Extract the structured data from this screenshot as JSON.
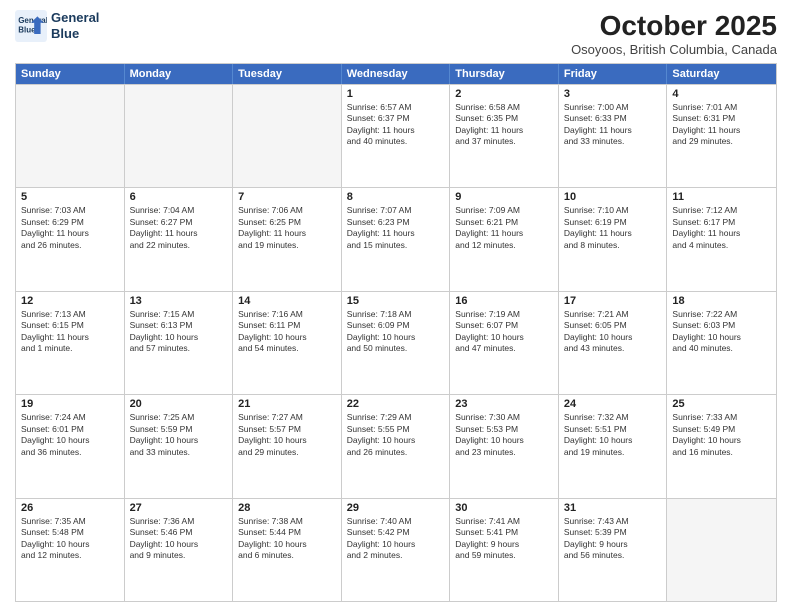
{
  "header": {
    "logo_line1": "General",
    "logo_line2": "Blue",
    "month_title": "October 2025",
    "subtitle": "Osoyoos, British Columbia, Canada"
  },
  "day_headers": [
    "Sunday",
    "Monday",
    "Tuesday",
    "Wednesday",
    "Thursday",
    "Friday",
    "Saturday"
  ],
  "weeks": [
    [
      {
        "day": "",
        "info": "",
        "empty": true
      },
      {
        "day": "",
        "info": "",
        "empty": true
      },
      {
        "day": "",
        "info": "",
        "empty": true
      },
      {
        "day": "1",
        "info": "Sunrise: 6:57 AM\nSunset: 6:37 PM\nDaylight: 11 hours\nand 40 minutes."
      },
      {
        "day": "2",
        "info": "Sunrise: 6:58 AM\nSunset: 6:35 PM\nDaylight: 11 hours\nand 37 minutes."
      },
      {
        "day": "3",
        "info": "Sunrise: 7:00 AM\nSunset: 6:33 PM\nDaylight: 11 hours\nand 33 minutes."
      },
      {
        "day": "4",
        "info": "Sunrise: 7:01 AM\nSunset: 6:31 PM\nDaylight: 11 hours\nand 29 minutes."
      }
    ],
    [
      {
        "day": "5",
        "info": "Sunrise: 7:03 AM\nSunset: 6:29 PM\nDaylight: 11 hours\nand 26 minutes."
      },
      {
        "day": "6",
        "info": "Sunrise: 7:04 AM\nSunset: 6:27 PM\nDaylight: 11 hours\nand 22 minutes."
      },
      {
        "day": "7",
        "info": "Sunrise: 7:06 AM\nSunset: 6:25 PM\nDaylight: 11 hours\nand 19 minutes."
      },
      {
        "day": "8",
        "info": "Sunrise: 7:07 AM\nSunset: 6:23 PM\nDaylight: 11 hours\nand 15 minutes."
      },
      {
        "day": "9",
        "info": "Sunrise: 7:09 AM\nSunset: 6:21 PM\nDaylight: 11 hours\nand 12 minutes."
      },
      {
        "day": "10",
        "info": "Sunrise: 7:10 AM\nSunset: 6:19 PM\nDaylight: 11 hours\nand 8 minutes."
      },
      {
        "day": "11",
        "info": "Sunrise: 7:12 AM\nSunset: 6:17 PM\nDaylight: 11 hours\nand 4 minutes."
      }
    ],
    [
      {
        "day": "12",
        "info": "Sunrise: 7:13 AM\nSunset: 6:15 PM\nDaylight: 11 hours\nand 1 minute."
      },
      {
        "day": "13",
        "info": "Sunrise: 7:15 AM\nSunset: 6:13 PM\nDaylight: 10 hours\nand 57 minutes."
      },
      {
        "day": "14",
        "info": "Sunrise: 7:16 AM\nSunset: 6:11 PM\nDaylight: 10 hours\nand 54 minutes."
      },
      {
        "day": "15",
        "info": "Sunrise: 7:18 AM\nSunset: 6:09 PM\nDaylight: 10 hours\nand 50 minutes."
      },
      {
        "day": "16",
        "info": "Sunrise: 7:19 AM\nSunset: 6:07 PM\nDaylight: 10 hours\nand 47 minutes."
      },
      {
        "day": "17",
        "info": "Sunrise: 7:21 AM\nSunset: 6:05 PM\nDaylight: 10 hours\nand 43 minutes."
      },
      {
        "day": "18",
        "info": "Sunrise: 7:22 AM\nSunset: 6:03 PM\nDaylight: 10 hours\nand 40 minutes."
      }
    ],
    [
      {
        "day": "19",
        "info": "Sunrise: 7:24 AM\nSunset: 6:01 PM\nDaylight: 10 hours\nand 36 minutes."
      },
      {
        "day": "20",
        "info": "Sunrise: 7:25 AM\nSunset: 5:59 PM\nDaylight: 10 hours\nand 33 minutes."
      },
      {
        "day": "21",
        "info": "Sunrise: 7:27 AM\nSunset: 5:57 PM\nDaylight: 10 hours\nand 29 minutes."
      },
      {
        "day": "22",
        "info": "Sunrise: 7:29 AM\nSunset: 5:55 PM\nDaylight: 10 hours\nand 26 minutes."
      },
      {
        "day": "23",
        "info": "Sunrise: 7:30 AM\nSunset: 5:53 PM\nDaylight: 10 hours\nand 23 minutes."
      },
      {
        "day": "24",
        "info": "Sunrise: 7:32 AM\nSunset: 5:51 PM\nDaylight: 10 hours\nand 19 minutes."
      },
      {
        "day": "25",
        "info": "Sunrise: 7:33 AM\nSunset: 5:49 PM\nDaylight: 10 hours\nand 16 minutes."
      }
    ],
    [
      {
        "day": "26",
        "info": "Sunrise: 7:35 AM\nSunset: 5:48 PM\nDaylight: 10 hours\nand 12 minutes."
      },
      {
        "day": "27",
        "info": "Sunrise: 7:36 AM\nSunset: 5:46 PM\nDaylight: 10 hours\nand 9 minutes."
      },
      {
        "day": "28",
        "info": "Sunrise: 7:38 AM\nSunset: 5:44 PM\nDaylight: 10 hours\nand 6 minutes."
      },
      {
        "day": "29",
        "info": "Sunrise: 7:40 AM\nSunset: 5:42 PM\nDaylight: 10 hours\nand 2 minutes."
      },
      {
        "day": "30",
        "info": "Sunrise: 7:41 AM\nSunset: 5:41 PM\nDaylight: 9 hours\nand 59 minutes."
      },
      {
        "day": "31",
        "info": "Sunrise: 7:43 AM\nSunset: 5:39 PM\nDaylight: 9 hours\nand 56 minutes."
      },
      {
        "day": "",
        "info": "",
        "empty": true
      }
    ]
  ]
}
